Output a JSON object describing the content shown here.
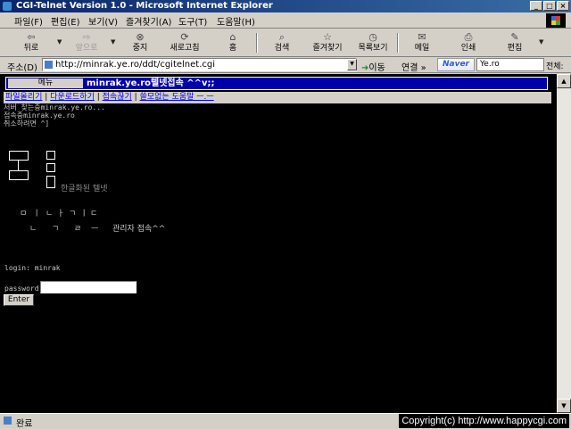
{
  "window": {
    "title": "CGI-Telnet Version 1.0 - Microsoft Internet Explorer",
    "controls": [
      "_",
      "□",
      "×"
    ]
  },
  "menubar": [
    "파일(F)",
    "편집(E)",
    "보기(V)",
    "즐겨찾기(A)",
    "도구(T)",
    "도움말(H)"
  ],
  "toolbar": {
    "back": "뒤로",
    "forward": "앞으로",
    "stop": "중지",
    "refresh": "새로고침",
    "home": "홈",
    "search": "검색",
    "favorites": "즐겨찾기",
    "history": "목록보기",
    "mail": "메일",
    "print": "인쇄",
    "edit": "편집"
  },
  "address": {
    "label": "주소(D)",
    "url": "http://minrak.ye.ro/ddt/cgitelnet.cgi",
    "go": "이동",
    "links": "연결 »",
    "naver_logo": "Naver",
    "search_value": "Ye.ro",
    "scope": "전체:"
  },
  "page": {
    "menu_label": "메뉴",
    "header_title": "minrak.ye.ro텔넷접속 ^^v;;",
    "links": [
      "파일올리기",
      "다운로드하기",
      "접속끊기",
      "쓸모없는 도움말 ㅡ.ㅡ"
    ],
    "term_lines": [
      "서버 찾는중minrak.ye.ro...",
      "접속중minrak.ye.ro",
      "취소하려면 ^]"
    ],
    "logo_caption": "한글화된 텔넷",
    "jamo_row1": [
      "ㅁ",
      "ㅣ",
      "ㄴ",
      "ㅏ",
      "ㄱ",
      "ㅣ",
      "ㄷ"
    ],
    "jamo_row2": [
      "ㄴ",
      "ㄱ",
      "ㄹ",
      "ㅡ"
    ],
    "admin_caption": "관리자 접속^^",
    "login_line": "login: minrak",
    "password_label": "password:",
    "password_value": "",
    "enter_button": "Enter"
  },
  "status": {
    "text": "완료",
    "copyright": "Copyright(c) http://www.happycgi.com"
  }
}
